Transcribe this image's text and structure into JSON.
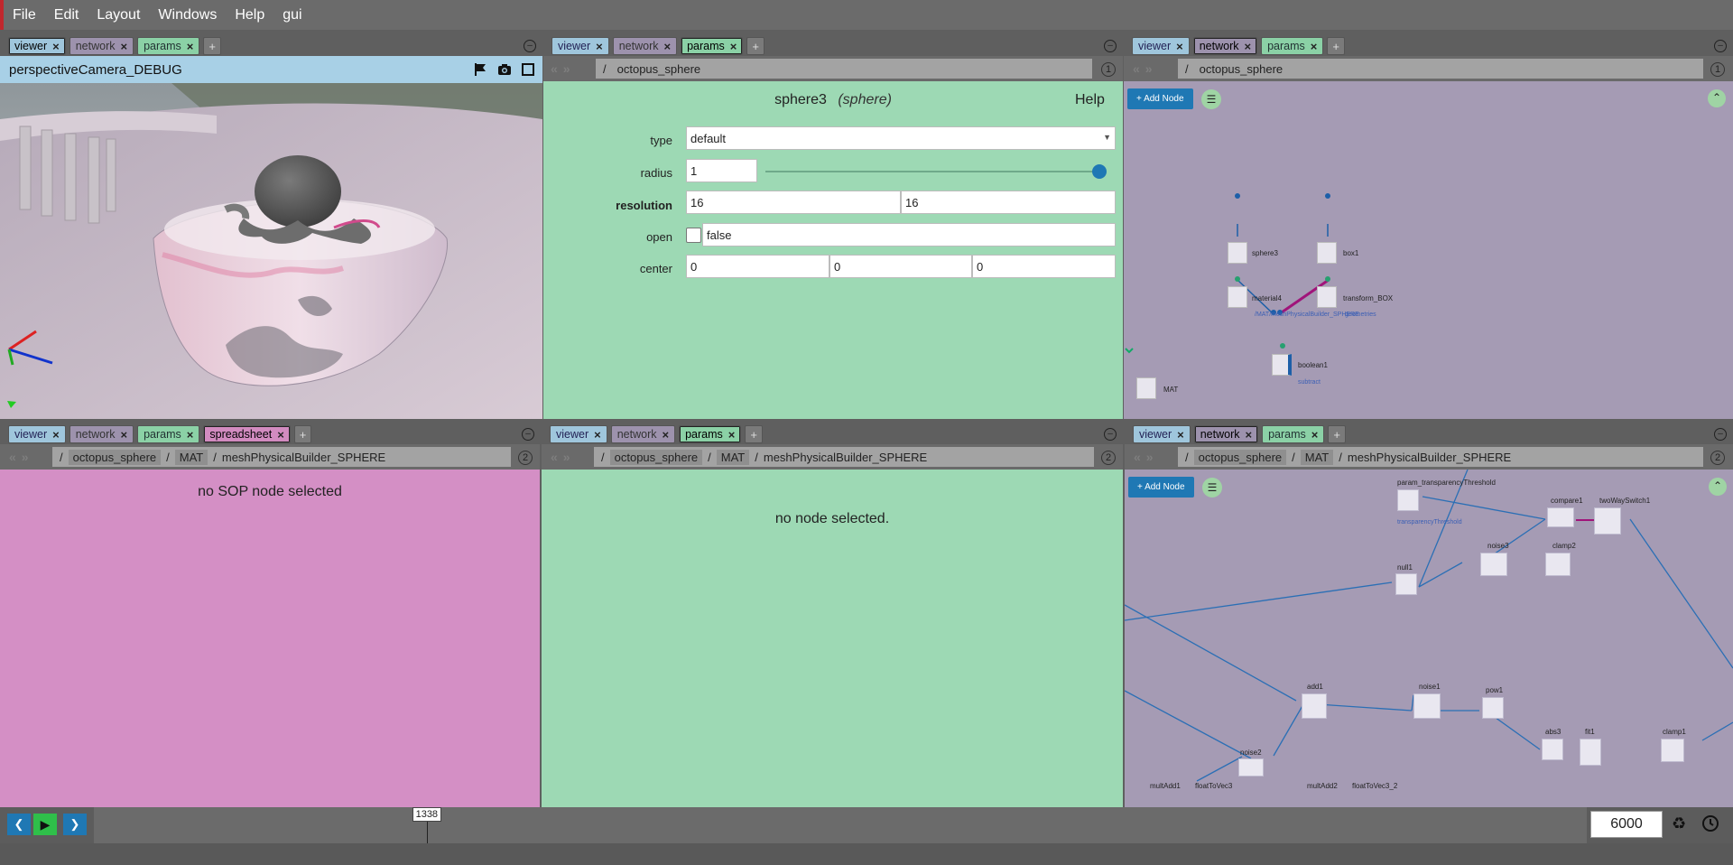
{
  "menu": [
    "File",
    "Edit",
    "Layout",
    "Windows",
    "Help",
    "gui"
  ],
  "tabs": {
    "viewer": "viewer",
    "network": "network",
    "params": "params",
    "spreadsheet": "spreadsheet",
    "plus": "+",
    "close": "×"
  },
  "viewer": {
    "camera_title": "perspectiveCamera_DEBUG"
  },
  "params_top": {
    "path_root": "/",
    "path": "octopus_sphere",
    "panel_number": "1",
    "node_name": "sphere3",
    "node_type": "(sphere)",
    "help": "Help",
    "type_label": "type",
    "type_value": "default",
    "radius_label": "radius",
    "radius_value": "1",
    "radius_slider_fraction": 1.0,
    "resolution_label": "resolution",
    "resolution_x": "16",
    "resolution_y": "16",
    "open_label": "open",
    "open_value": "false",
    "center_label": "center",
    "center_x": "0",
    "center_y": "0",
    "center_z": "0"
  },
  "network_top": {
    "path_root": "/",
    "path": "octopus_sphere",
    "panel_number": "1",
    "add_node": "+ Add Node",
    "nodes": {
      "sphere3": "sphere3",
      "box1": "box1",
      "material4": "material4",
      "material_path": "/MAT/meshPhysicalBuilder_SPHERE",
      "transform_box": "transform_BOX",
      "transform_sub": "geometries",
      "boolean1": "boolean1",
      "boolean_sub": "subtract",
      "mat": "MAT"
    }
  },
  "spreadsheet": {
    "path_root": "/",
    "crumbs": [
      "octopus_sphere",
      "MAT",
      "meshPhysicalBuilder_SPHERE"
    ],
    "sep": "/",
    "panel_number": "2",
    "message": "no SOP node selected"
  },
  "params_bottom": {
    "path_root": "/",
    "crumbs": [
      "octopus_sphere",
      "MAT",
      "meshPhysicalBuilder_SPHERE"
    ],
    "sep": "/",
    "panel_number": "2",
    "message": "no node selected."
  },
  "network_bottom": {
    "path_root": "/",
    "crumbs": [
      "octopus_sphere",
      "MAT",
      "meshPhysicalBuilder_SPHERE"
    ],
    "sep": "/",
    "panel_number": "2",
    "add_node": "+ Add Node",
    "nodes": {
      "param_transparency": "param_transparencyThreshold",
      "transparency_sub": "transparencyThreshold",
      "compare1": "compare1",
      "twoWaySwitch1": "twoWaySwitch1",
      "noise3": "noise3",
      "clamp2": "clamp2",
      "null1": "null1",
      "add1": "add1",
      "noise1": "noise1",
      "pow1": "pow1",
      "abs3": "abs3",
      "fit1": "fit1",
      "clamp1": "clamp1",
      "noise2": "noise2",
      "multAdd1": "multAdd1",
      "floatToVec3": "floatToVec3",
      "multAdd2": "multAdd2",
      "floatToVec3_2": "floatToVec3_2"
    }
  },
  "timeline": {
    "current_frame": "1338",
    "current_fraction": 0.223,
    "end_frame": "6000"
  },
  "colors": {
    "viewer": "#9fc6dc",
    "network": "#9d92ad",
    "params": "#9dd9b4",
    "spreadsheet": "#d48fc5",
    "accent": "#1f78b4"
  }
}
